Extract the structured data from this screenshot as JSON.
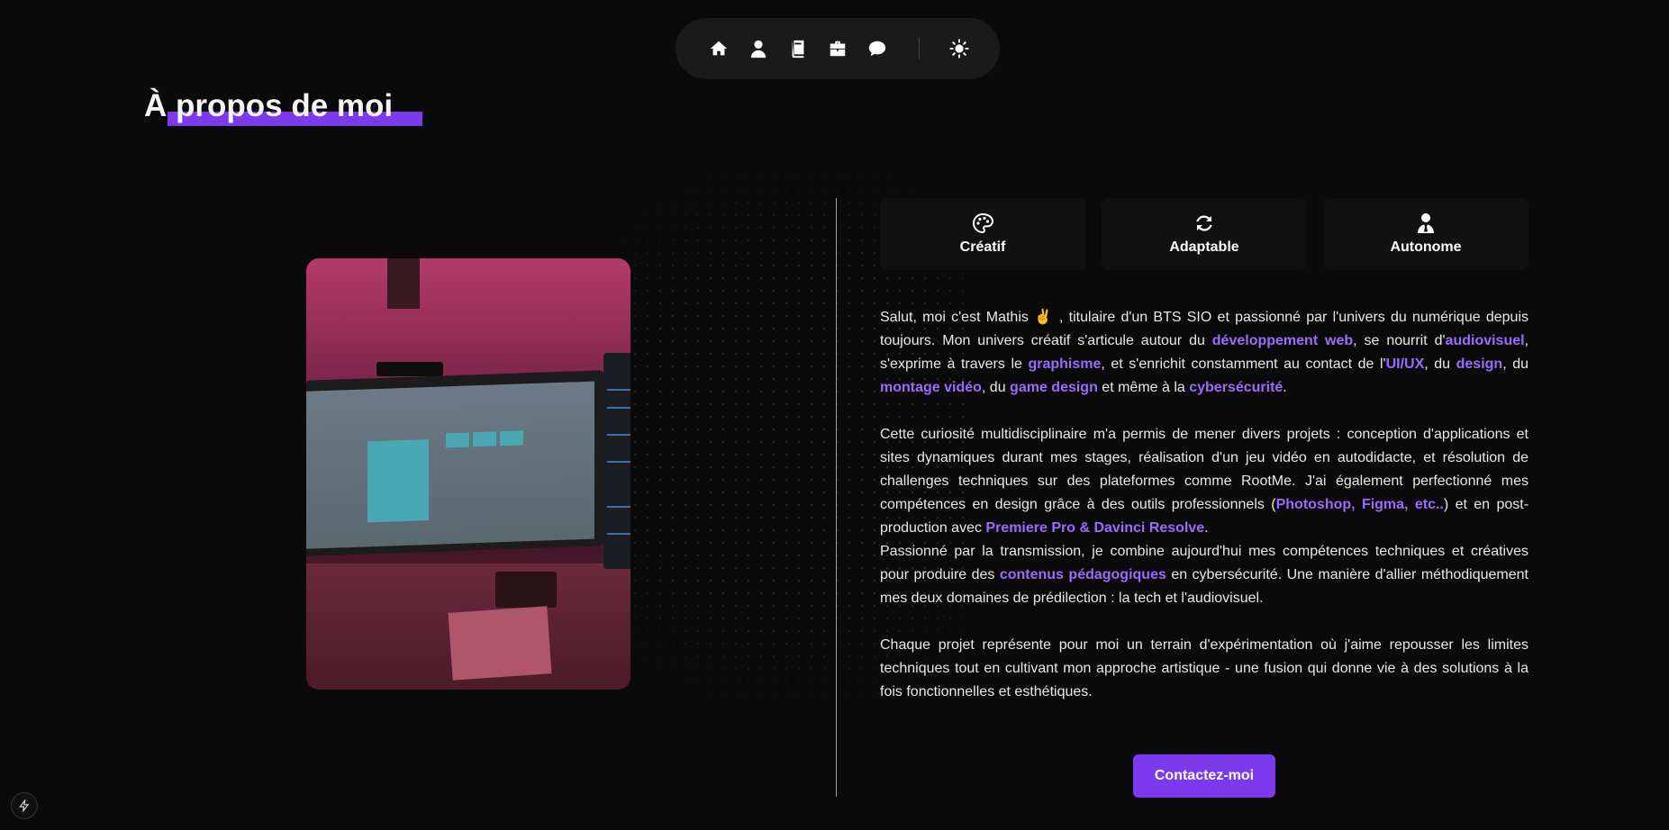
{
  "nav": {
    "items": [
      {
        "icon": "home-icon"
      },
      {
        "icon": "user-icon"
      },
      {
        "icon": "book-icon"
      },
      {
        "icon": "briefcase-icon"
      },
      {
        "icon": "chat-icon"
      }
    ],
    "theme_icon": "sun-icon"
  },
  "section": {
    "title": "À propos de moi"
  },
  "traits": [
    {
      "label": "Créatif",
      "icon": "palette-icon"
    },
    {
      "label": "Adaptable",
      "icon": "refresh-icon"
    },
    {
      "label": "Autonome",
      "icon": "user-tie-icon"
    }
  ],
  "bio": {
    "p1": {
      "t1": "Salut, moi c'est Mathis ✌️ , titulaire d'un BTS SIO et passionné par l'univers du numérique depuis toujours. Mon univers créatif s'articule autour du ",
      "h1": "développement web",
      "t2": ", se nourrit d'",
      "h2": "audiovisuel",
      "t3": ", s'exprime à travers le ",
      "h3": "graphisme",
      "t4": ", et s'enrichit constamment au contact de l'",
      "h4": "UI/UX",
      "t5": ", du ",
      "h5": "design",
      "t6": ", du ",
      "h6": "montage vidéo",
      "t7": ", du ",
      "h7": "game design",
      "t8": " et même à la ",
      "h8": "cybersécurité",
      "t9": "."
    },
    "p2": {
      "t1": "Cette curiosité multidisciplinaire m'a permis de mener divers projets : conception d'applications et sites dynamiques durant mes stages, réalisation d'un jeu vidéo en autodidacte, et résolution de challenges techniques sur des plateformes comme RootMe. J'ai également perfectionné mes compétences en design grâce à des outils professionnels (",
      "h1": "Photoshop, Figma, etc..",
      "t2": ") et en post-production avec ",
      "h2": "Premiere Pro & Davinci Resolve",
      "t3": "."
    },
    "p3": {
      "t1": "Passionné par la transmission, je combine aujourd'hui mes compétences techniques et créatives pour produire des ",
      "h1": "contenus pédagogiques",
      "t2": " en cybersécurité. Une manière d'allier méthodiquement mes deux domaines de prédilection : la tech et l'audiovisuel."
    },
    "p4": "Chaque projet représente pour moi un terrain d'expérimentation où j'aime repousser les limites techniques tout en cultivant mon approche artistique - une fusion qui donne vie à des solutions à la fois fonctionnelles et esthétiques."
  },
  "cta": {
    "label": "Contactez-moi"
  },
  "badge": {
    "icon": "bolt-icon"
  },
  "colors": {
    "accent": "#7c3aed",
    "highlight": "#9b6bff",
    "background": "#0a0a0a",
    "card": "#111111"
  }
}
